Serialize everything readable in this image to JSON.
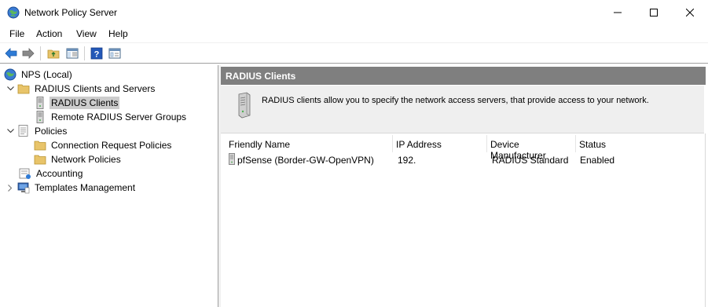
{
  "window": {
    "title": "Network Policy Server",
    "icon": "nps-globe-icon",
    "controls": [
      "minimize",
      "maximize",
      "close"
    ]
  },
  "menu": {
    "items": [
      "File",
      "Action",
      "View",
      "Help"
    ]
  },
  "toolbar": {
    "buttons": [
      "back-arrow-icon",
      "forward-arrow-icon",
      "folder-up-icon",
      "show-hide-tree-icon",
      "help-icon",
      "properties-icon"
    ]
  },
  "tree": {
    "root": "NPS (Local)",
    "radius_clients_servers": "RADIUS Clients and Servers",
    "radius_clients": "RADIUS Clients",
    "remote_groups": "Remote RADIUS Server Groups",
    "policies": "Policies",
    "connection_request": "Connection Request Policies",
    "network_policies": "Network Policies",
    "accounting": "Accounting",
    "templates": "Templates Management",
    "selected": "RADIUS Clients"
  },
  "main": {
    "header": "RADIUS Clients",
    "description": "RADIUS clients allow you to specify the network access servers, that provide access to your network.",
    "columns": [
      "Friendly Name",
      "IP Address",
      "Device Manufacturer",
      "Status"
    ],
    "rows": [
      {
        "name": "pfSense (Border-GW-OpenVPN)",
        "ip": "192.",
        "manufacturer": "RADIUS Standard",
        "status": "Enabled"
      }
    ]
  },
  "colors": {
    "header_bg": "#7f7f7f",
    "desc_bg": "#efefef",
    "selection_bg": "#cccccc",
    "folder": "#e8c46a"
  }
}
